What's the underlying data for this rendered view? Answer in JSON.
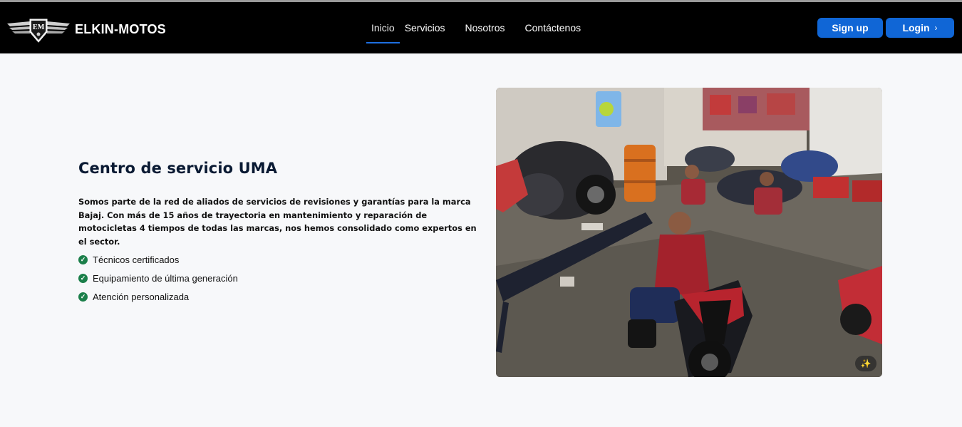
{
  "brand": {
    "name": "ELKIN-MOTOS",
    "logo_text": "EM"
  },
  "nav": {
    "items": [
      {
        "label": "Inicio",
        "active": true
      },
      {
        "label": "Servicios",
        "active": false
      },
      {
        "label": "Nosotros",
        "active": false
      },
      {
        "label": "Contáctenos",
        "active": false
      }
    ]
  },
  "auth": {
    "signup_label": "Sign up",
    "login_label": "Login"
  },
  "hero": {
    "title": "Centro de servicio UMA",
    "description": "Somos parte de la red de aliados de servicios de revisiones y garantías para la marca Bajaj. Con más de 15 años de trayectoria en mantenimiento y reparación de motocicletas 4 tiempos de todas las marcas, nos hemos consolidado como expertos en el sector.",
    "features": [
      "Técnicos certificados",
      "Equipamiento de última generación",
      "Atención personalizada"
    ]
  },
  "colors": {
    "navbar_bg": "#000000",
    "accent": "#1066d6",
    "check": "#1b7f4a",
    "title": "#0a1a33"
  },
  "icons": {
    "check": "check-circle-icon",
    "chevron": "chevron-right-icon",
    "expand": "magic-wand-icon"
  }
}
